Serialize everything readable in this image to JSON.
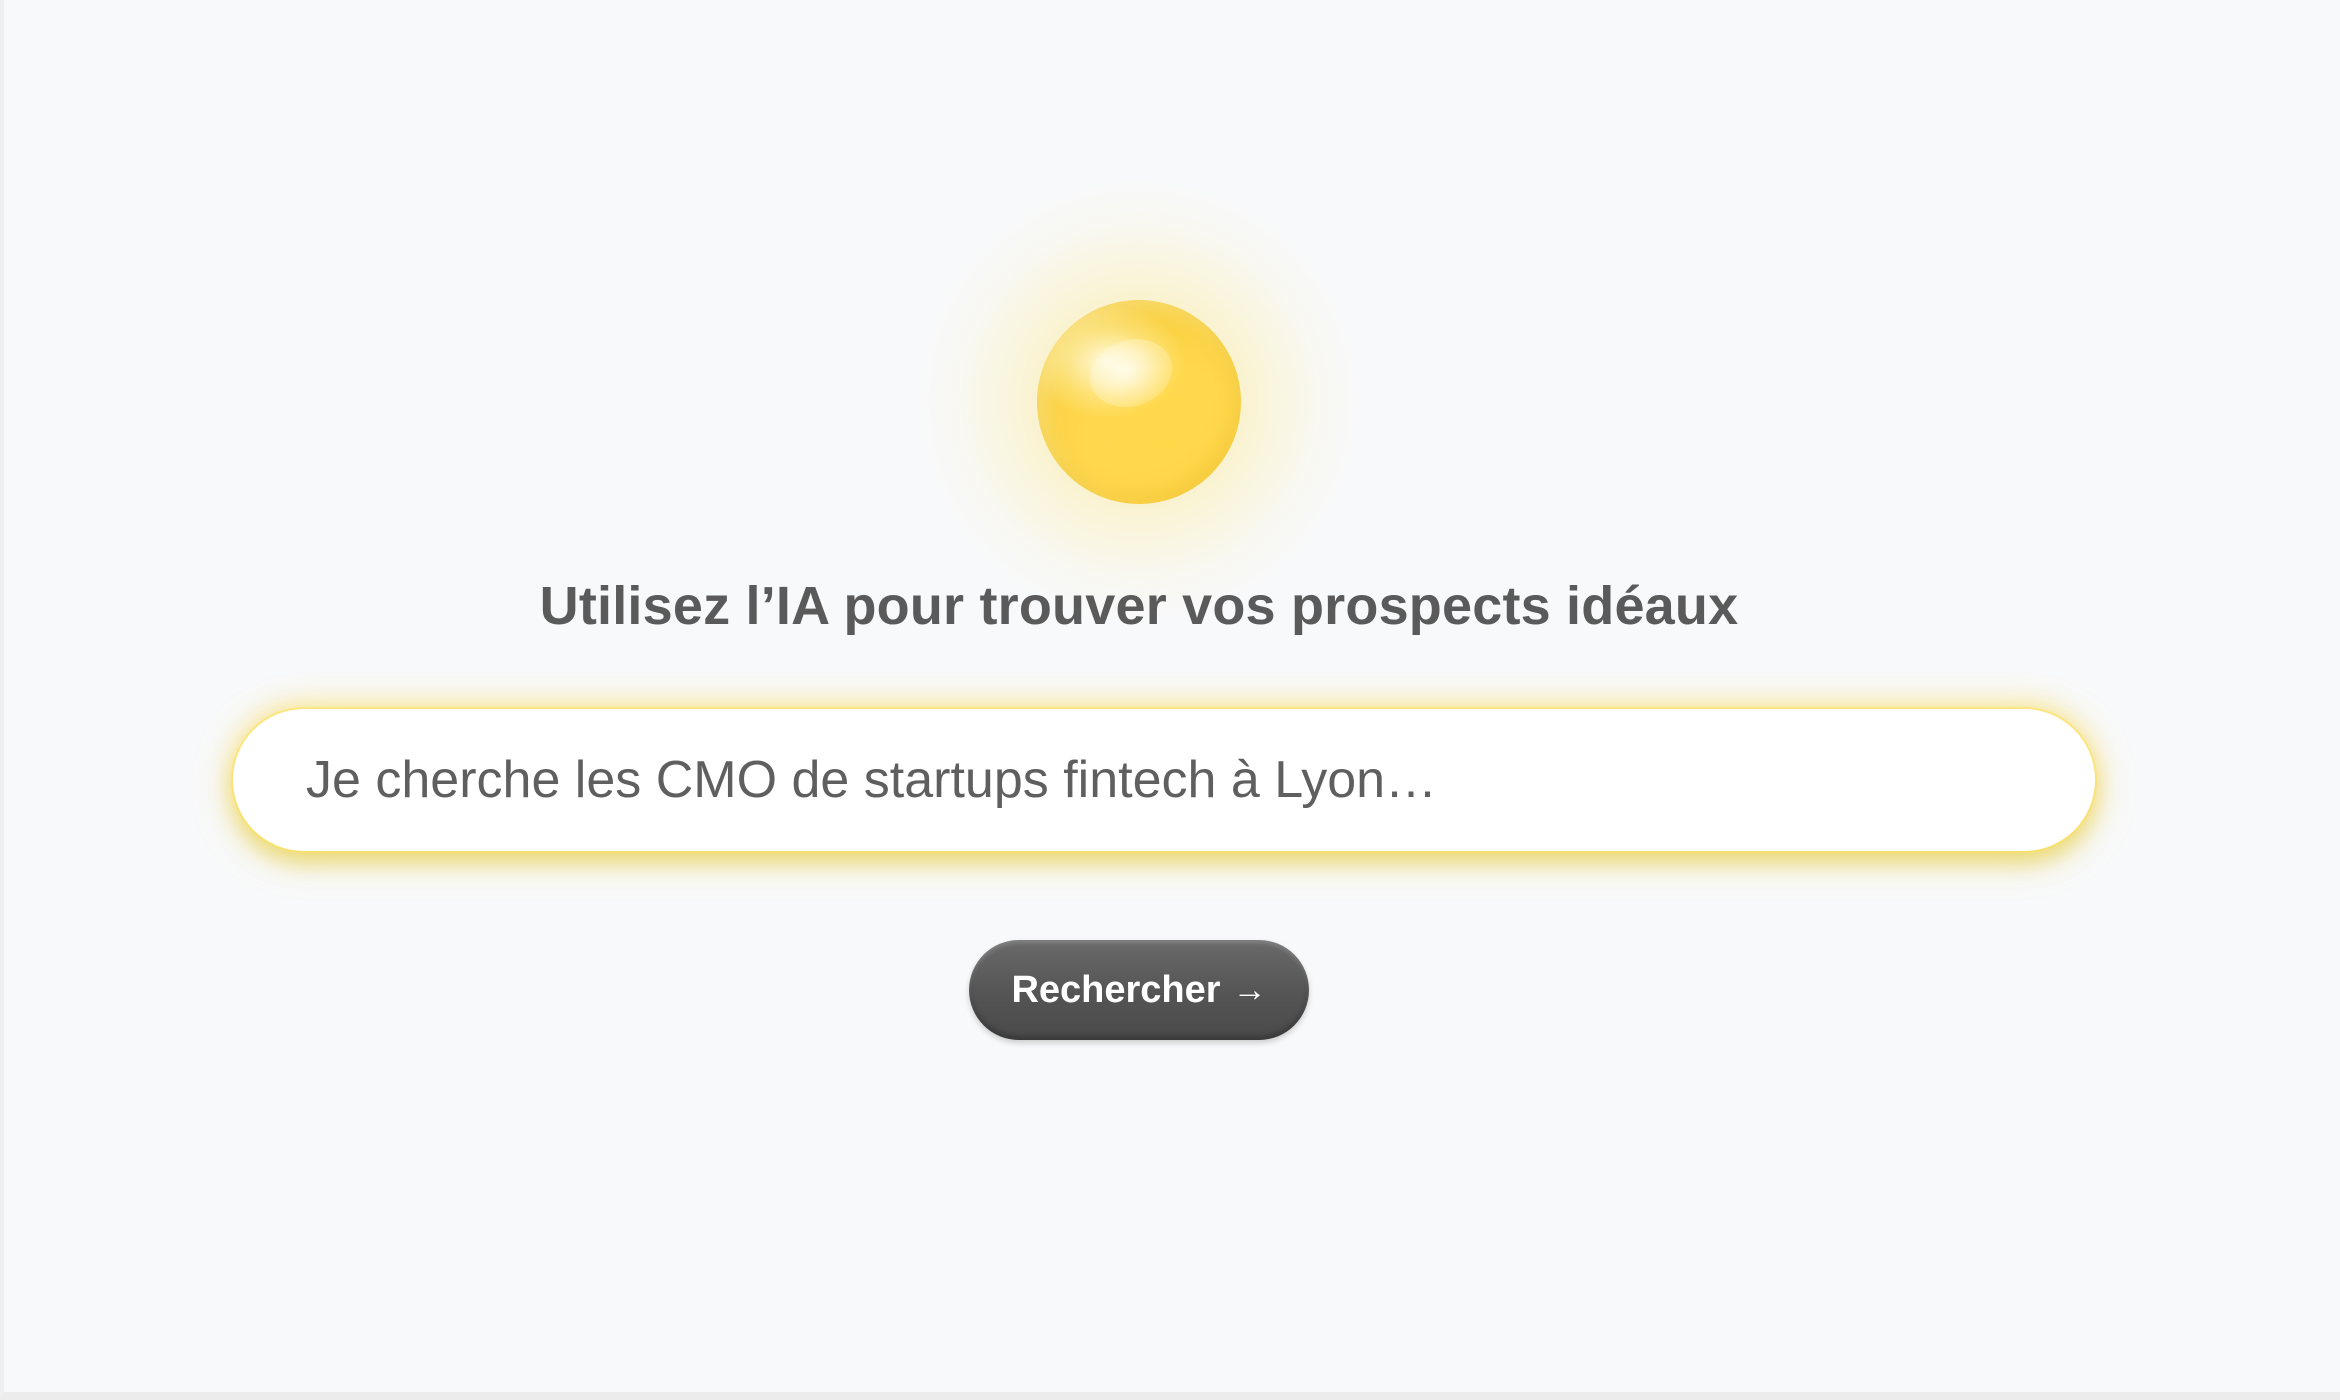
{
  "hero": {
    "title": "Utilisez l’IA pour trouver vos prospects idéaux",
    "orb_icon": "sun-orb-icon",
    "accent_color": "#ffd84e"
  },
  "search": {
    "placeholder": "Je cherche les CMO de startups fintech à Lyon…",
    "value": ""
  },
  "action": {
    "button_label": "Rechercher",
    "button_icon": "arrow-right-icon",
    "button_glyph": "→",
    "button_color": "#555555"
  }
}
